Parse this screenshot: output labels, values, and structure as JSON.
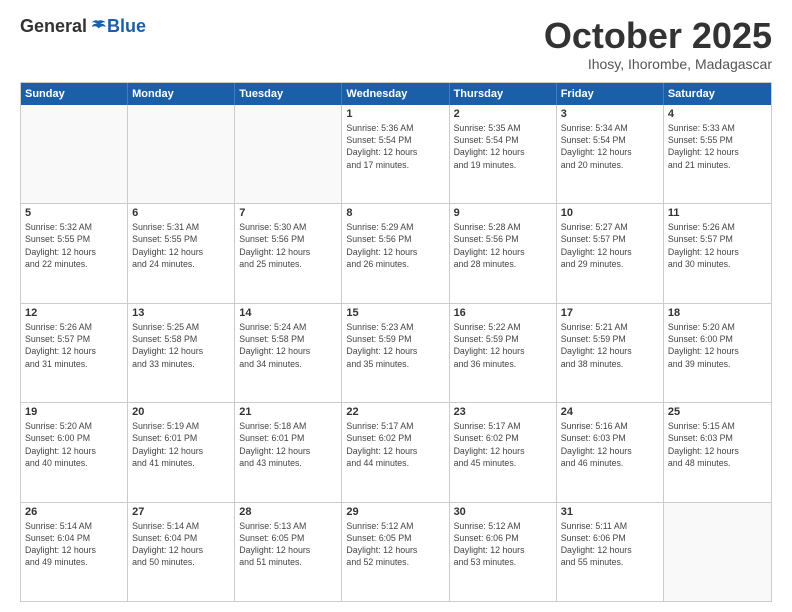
{
  "logo": {
    "general": "General",
    "blue": "Blue"
  },
  "title": "October 2025",
  "subtitle": "Ihosy, Ihorombe, Madagascar",
  "headers": [
    "Sunday",
    "Monday",
    "Tuesday",
    "Wednesday",
    "Thursday",
    "Friday",
    "Saturday"
  ],
  "weeks": [
    [
      {
        "day": "",
        "info": ""
      },
      {
        "day": "",
        "info": ""
      },
      {
        "day": "",
        "info": ""
      },
      {
        "day": "1",
        "info": "Sunrise: 5:36 AM\nSunset: 5:54 PM\nDaylight: 12 hours\nand 17 minutes."
      },
      {
        "day": "2",
        "info": "Sunrise: 5:35 AM\nSunset: 5:54 PM\nDaylight: 12 hours\nand 19 minutes."
      },
      {
        "day": "3",
        "info": "Sunrise: 5:34 AM\nSunset: 5:54 PM\nDaylight: 12 hours\nand 20 minutes."
      },
      {
        "day": "4",
        "info": "Sunrise: 5:33 AM\nSunset: 5:55 PM\nDaylight: 12 hours\nand 21 minutes."
      }
    ],
    [
      {
        "day": "5",
        "info": "Sunrise: 5:32 AM\nSunset: 5:55 PM\nDaylight: 12 hours\nand 22 minutes."
      },
      {
        "day": "6",
        "info": "Sunrise: 5:31 AM\nSunset: 5:55 PM\nDaylight: 12 hours\nand 24 minutes."
      },
      {
        "day": "7",
        "info": "Sunrise: 5:30 AM\nSunset: 5:56 PM\nDaylight: 12 hours\nand 25 minutes."
      },
      {
        "day": "8",
        "info": "Sunrise: 5:29 AM\nSunset: 5:56 PM\nDaylight: 12 hours\nand 26 minutes."
      },
      {
        "day": "9",
        "info": "Sunrise: 5:28 AM\nSunset: 5:56 PM\nDaylight: 12 hours\nand 28 minutes."
      },
      {
        "day": "10",
        "info": "Sunrise: 5:27 AM\nSunset: 5:57 PM\nDaylight: 12 hours\nand 29 minutes."
      },
      {
        "day": "11",
        "info": "Sunrise: 5:26 AM\nSunset: 5:57 PM\nDaylight: 12 hours\nand 30 minutes."
      }
    ],
    [
      {
        "day": "12",
        "info": "Sunrise: 5:26 AM\nSunset: 5:57 PM\nDaylight: 12 hours\nand 31 minutes."
      },
      {
        "day": "13",
        "info": "Sunrise: 5:25 AM\nSunset: 5:58 PM\nDaylight: 12 hours\nand 33 minutes."
      },
      {
        "day": "14",
        "info": "Sunrise: 5:24 AM\nSunset: 5:58 PM\nDaylight: 12 hours\nand 34 minutes."
      },
      {
        "day": "15",
        "info": "Sunrise: 5:23 AM\nSunset: 5:59 PM\nDaylight: 12 hours\nand 35 minutes."
      },
      {
        "day": "16",
        "info": "Sunrise: 5:22 AM\nSunset: 5:59 PM\nDaylight: 12 hours\nand 36 minutes."
      },
      {
        "day": "17",
        "info": "Sunrise: 5:21 AM\nSunset: 5:59 PM\nDaylight: 12 hours\nand 38 minutes."
      },
      {
        "day": "18",
        "info": "Sunrise: 5:20 AM\nSunset: 6:00 PM\nDaylight: 12 hours\nand 39 minutes."
      }
    ],
    [
      {
        "day": "19",
        "info": "Sunrise: 5:20 AM\nSunset: 6:00 PM\nDaylight: 12 hours\nand 40 minutes."
      },
      {
        "day": "20",
        "info": "Sunrise: 5:19 AM\nSunset: 6:01 PM\nDaylight: 12 hours\nand 41 minutes."
      },
      {
        "day": "21",
        "info": "Sunrise: 5:18 AM\nSunset: 6:01 PM\nDaylight: 12 hours\nand 43 minutes."
      },
      {
        "day": "22",
        "info": "Sunrise: 5:17 AM\nSunset: 6:02 PM\nDaylight: 12 hours\nand 44 minutes."
      },
      {
        "day": "23",
        "info": "Sunrise: 5:17 AM\nSunset: 6:02 PM\nDaylight: 12 hours\nand 45 minutes."
      },
      {
        "day": "24",
        "info": "Sunrise: 5:16 AM\nSunset: 6:03 PM\nDaylight: 12 hours\nand 46 minutes."
      },
      {
        "day": "25",
        "info": "Sunrise: 5:15 AM\nSunset: 6:03 PM\nDaylight: 12 hours\nand 48 minutes."
      }
    ],
    [
      {
        "day": "26",
        "info": "Sunrise: 5:14 AM\nSunset: 6:04 PM\nDaylight: 12 hours\nand 49 minutes."
      },
      {
        "day": "27",
        "info": "Sunrise: 5:14 AM\nSunset: 6:04 PM\nDaylight: 12 hours\nand 50 minutes."
      },
      {
        "day": "28",
        "info": "Sunrise: 5:13 AM\nSunset: 6:05 PM\nDaylight: 12 hours\nand 51 minutes."
      },
      {
        "day": "29",
        "info": "Sunrise: 5:12 AM\nSunset: 6:05 PM\nDaylight: 12 hours\nand 52 minutes."
      },
      {
        "day": "30",
        "info": "Sunrise: 5:12 AM\nSunset: 6:06 PM\nDaylight: 12 hours\nand 53 minutes."
      },
      {
        "day": "31",
        "info": "Sunrise: 5:11 AM\nSunset: 6:06 PM\nDaylight: 12 hours\nand 55 minutes."
      },
      {
        "day": "",
        "info": ""
      }
    ]
  ]
}
